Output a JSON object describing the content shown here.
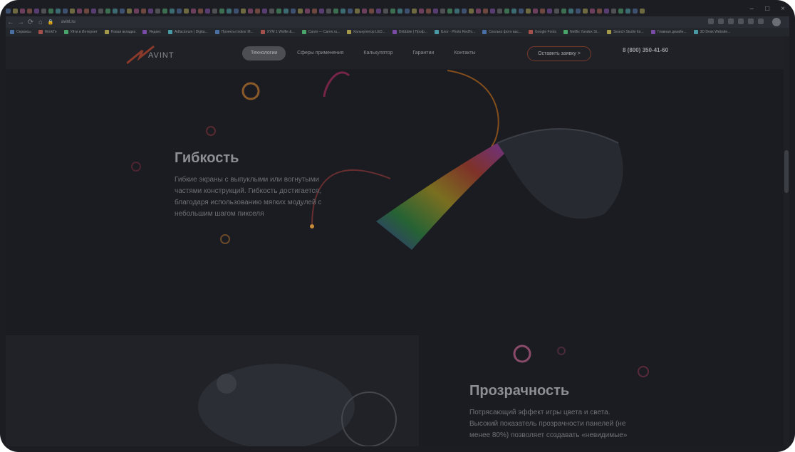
{
  "browser": {
    "url": "avint.ru",
    "bookmarks": [
      "Сервисы",
      "WorkTo",
      "Уйти в Интернет",
      "Новая вкладка",
      "Яндекс",
      "Adfactorum | Digita...",
      "Проекты Indexr M...",
      "XYM 1 Wolfie &...",
      "Canm — Canm.ru...",
      "Калькулятор LED...",
      "Dribbble | Проф...",
      "Блог - Photo RedTo...",
      "Сколько фото вас...",
      "Google Fonts",
      "Netflix Yandex St...",
      "Search Studio for...",
      "Главная дизайн...",
      "3D Desk Website..."
    ]
  },
  "site": {
    "logo_text": "AVINT",
    "menu": [
      "Технологии",
      "Сферы применения",
      "Калькулятор",
      "Гарантии",
      "Контакты"
    ],
    "active_menu": "Технологии",
    "cta_label": "Оставить заявку >",
    "phone": "8 (800) 350-41-60"
  },
  "sections": {
    "flex": {
      "title": "Гибкость",
      "text": "Гибкие экраны с выпуклыми или вогнутыми частями конструкций. Гибкость достигается, благодаря использованию мягких модулей с небольшим шагом пикселя"
    },
    "transparency": {
      "title": "Прозрачность",
      "text": "Потрясающий эффект игры цвета и света. Высокий показатель прозрачности панелей (не менее 80%) позволяет создавать «невидимые»"
    }
  }
}
